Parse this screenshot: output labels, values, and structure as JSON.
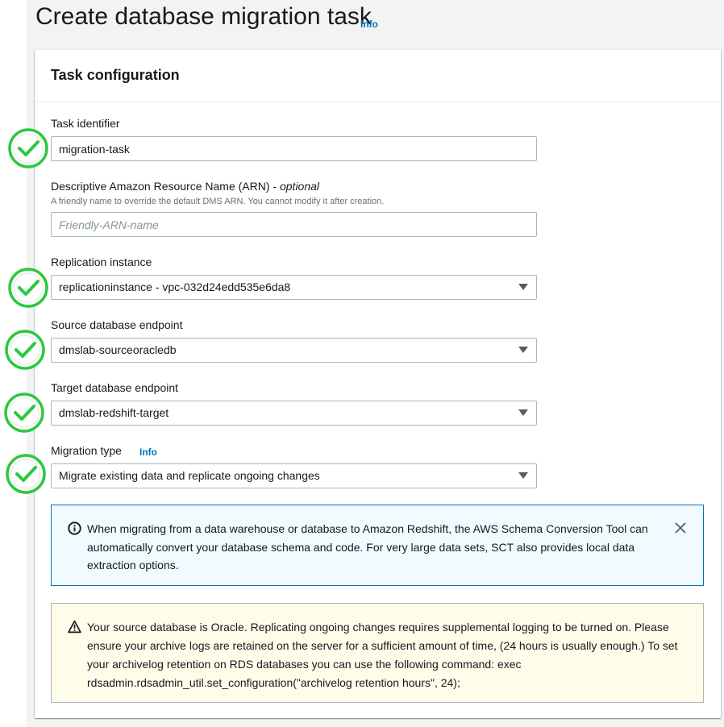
{
  "page": {
    "title": "Create database migration task",
    "title_info": "Info"
  },
  "panel": {
    "title": "Task configuration"
  },
  "fields": {
    "task_identifier": {
      "label": "Task identifier",
      "value": "migration-task"
    },
    "arn": {
      "label": "Descriptive Amazon Resource Name (ARN) - ",
      "optional": "optional",
      "description": "A friendly name to override the default DMS ARN. You cannot modify it after creation.",
      "placeholder": "Friendly-ARN-name",
      "value": ""
    },
    "replication_instance": {
      "label": "Replication instance",
      "value": "replicationinstance - vpc-032d24edd535e6da8"
    },
    "source_endpoint": {
      "label": "Source database endpoint",
      "value": "dmslab-sourceoracledb"
    },
    "target_endpoint": {
      "label": "Target database endpoint",
      "value": "dmslab-redshift-target"
    },
    "migration_type": {
      "label": "Migration type",
      "info": "Info",
      "value": "Migrate existing data and replicate ongoing changes"
    }
  },
  "alerts": {
    "info": "When migrating from a data warehouse or database to Amazon Redshift, the AWS Schema Conversion Tool can automatically convert your database schema and code. For very large data sets, SCT also provides local data extraction options.",
    "warning": "Your source database is Oracle. Replicating ongoing changes requires supplemental logging to be turned on. Please ensure your archive logs are retained on the server for a sufficient amount of time, (24 hours is usually enough.) To set your archivelog retention on RDS databases you can use the following command: exec rdsadmin.rdsadmin_util.set_configuration(\"archivelog retention hours\", 24);"
  },
  "icons": {
    "check": "check-circle-icon",
    "info": "info-circle-icon",
    "warning": "warning-triangle-icon",
    "close": "close-icon",
    "caret": "caret-down-icon"
  },
  "colors": {
    "accent": "#0073bb",
    "check_green": "#2cc93c",
    "info_bg": "#f1faff",
    "warning_bg": "#fffce9"
  }
}
